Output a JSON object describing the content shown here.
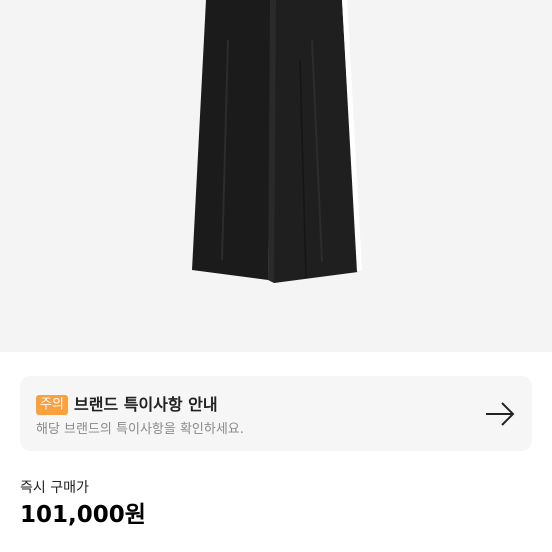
{
  "notice": {
    "badge": "주의",
    "title": "브랜드 특이사항 안내",
    "description": "해당 브랜드의 특이사항을 확인하세요."
  },
  "price": {
    "label": "즉시 구매가",
    "value": "101,000원"
  },
  "icons": {
    "notice_arrow": "arrow-right-icon"
  },
  "colors": {
    "badge_bg": "#f9a03f",
    "card_bg": "#f6f6f6",
    "image_bg": "#f4f4f4"
  }
}
